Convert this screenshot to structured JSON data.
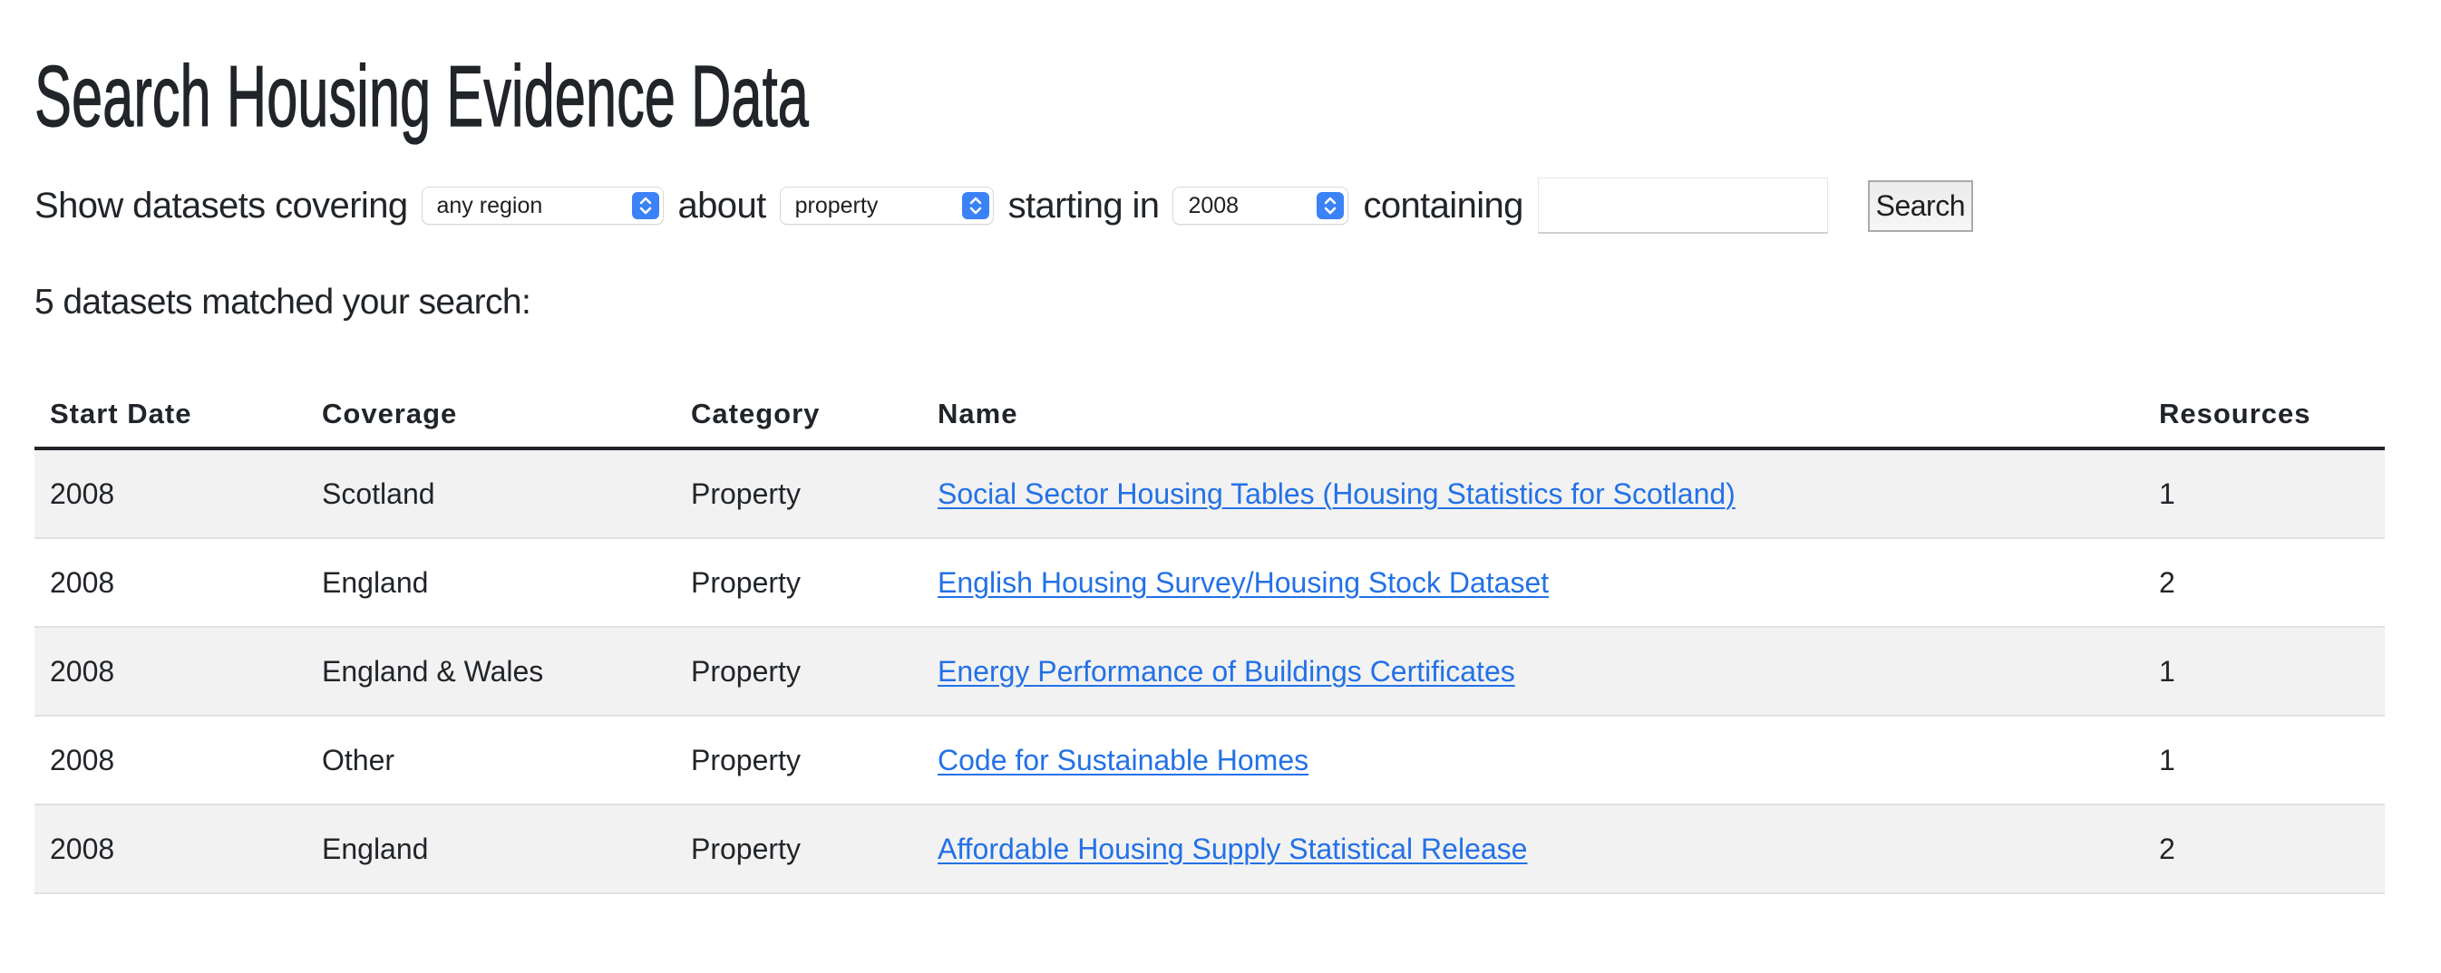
{
  "page": {
    "title": "Search Housing Evidence Data"
  },
  "filters": {
    "label_covering": "Show datasets covering",
    "region_select": {
      "value": "any region"
    },
    "label_about": "about",
    "topic_select": {
      "value": "property"
    },
    "label_starting": "starting in",
    "year_select": {
      "value": "2008"
    },
    "label_containing": "containing",
    "search_input": {
      "value": "",
      "placeholder": ""
    },
    "search_button": "Search",
    "select_arrow_icon": "up-down-chevron-icon",
    "accent_color": "#3b82f6"
  },
  "results": {
    "summary": "5 datasets matched your search:",
    "columns": [
      "Start Date",
      "Coverage",
      "Category",
      "Name",
      "Resources"
    ],
    "link_color": "#2371e7",
    "rows": [
      {
        "start_date": "2008",
        "coverage": "Scotland",
        "category": "Property",
        "name": "Social Sector Housing Tables (Housing Statistics for Scotland)",
        "resources": "1"
      },
      {
        "start_date": "2008",
        "coverage": "England",
        "category": "Property",
        "name": "English Housing Survey/Housing Stock Dataset",
        "resources": "2"
      },
      {
        "start_date": "2008",
        "coverage": "England & Wales",
        "category": "Property",
        "name": "Energy Performance of Buildings Certificates",
        "resources": "1"
      },
      {
        "start_date": "2008",
        "coverage": "Other",
        "category": "Property",
        "name": "Code for Sustainable Homes",
        "resources": "1"
      },
      {
        "start_date": "2008",
        "coverage": "England",
        "category": "Property",
        "name": "Affordable Housing Supply Statistical Release",
        "resources": "2"
      }
    ]
  }
}
